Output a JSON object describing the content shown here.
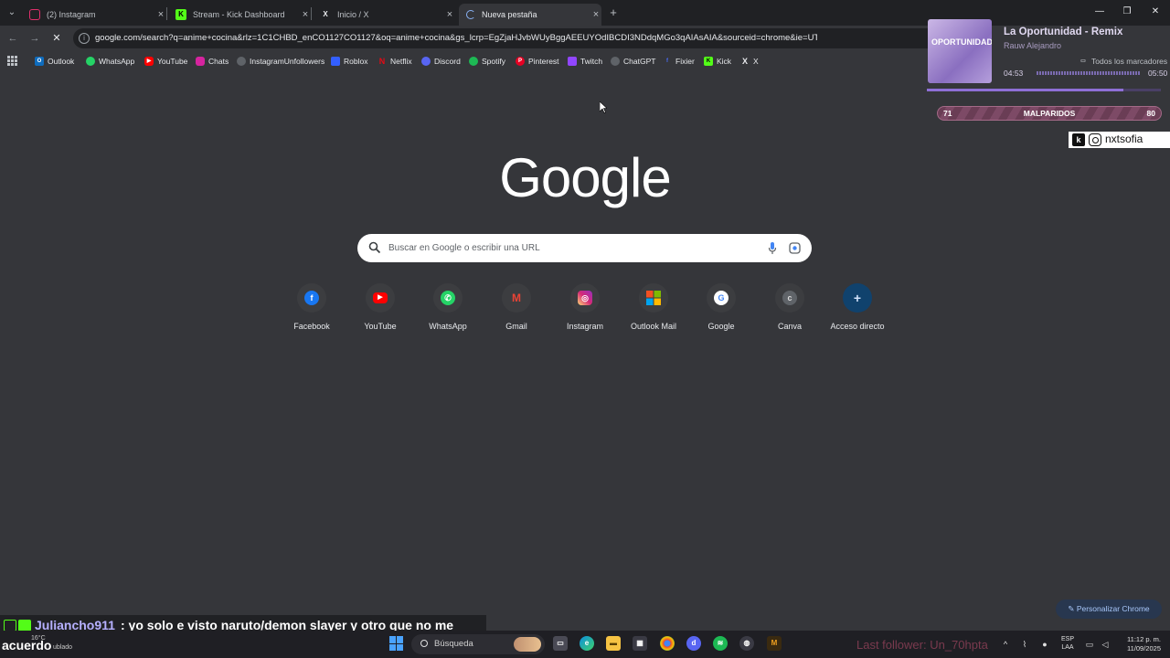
{
  "tabs": [
    {
      "title": "(2) Instagram",
      "icon": "instagram-icon"
    },
    {
      "title": "Stream - Kick Dashboard",
      "icon": "kick-icon"
    },
    {
      "title": "Inicio / X",
      "icon": "x-icon"
    },
    {
      "title": "Nueva pestaña",
      "icon": "loading-spinner-icon",
      "active": true
    }
  ],
  "omnibox": {
    "url": "google.com/search?q=anime+cocina&rlz=1C1CHBD_enCO1127CO1127&oq=anime+cocina&gs_lcrp=EgZjaHJvbWUyBggAEEUYOdIBCDI3NDdqMGo3qAIAsAIA&sourceid=chrome&ie=UTF-8"
  },
  "bookmarks": {
    "items": [
      {
        "label": "Outlook",
        "color": "#0f6cbd"
      },
      {
        "label": "WhatsApp",
        "color": "#25d366"
      },
      {
        "label": "YouTube",
        "color": "#ff0000"
      },
      {
        "label": "Chats",
        "color": "#d6249f"
      },
      {
        "label": "InstagramUnfollowers",
        "color": "#9aa0a6"
      },
      {
        "label": "Roblox",
        "color": "#335fff"
      },
      {
        "label": "Netflix",
        "color": "#e50914"
      },
      {
        "label": "Discord",
        "color": "#5865f2"
      },
      {
        "label": "Spotify",
        "color": "#1db954"
      },
      {
        "label": "Pinterest",
        "color": "#e60023"
      },
      {
        "label": "Twitch",
        "color": "#9146ff"
      },
      {
        "label": "ChatGPT",
        "color": "#9aa0a6"
      },
      {
        "label": "Fixier",
        "color": "#4a6cf7"
      },
      {
        "label": "Kick",
        "color": "#53fc18"
      },
      {
        "label": "X",
        "color": "#000000"
      }
    ],
    "all_label": "Todos los marcadores"
  },
  "google": {
    "logo": "Google",
    "search_placeholder": "Buscar en Google o escribir una URL",
    "shortcuts": [
      {
        "label": "Facebook",
        "color": "#1877f2",
        "glyph": "f"
      },
      {
        "label": "YouTube",
        "color": "#ff0000",
        "glyph": "▶"
      },
      {
        "label": "WhatsApp",
        "color": "#25d366",
        "glyph": "✆"
      },
      {
        "label": "Gmail",
        "color": "#ea4335",
        "glyph": "M"
      },
      {
        "label": "Instagram",
        "color": "#d6249f",
        "glyph": "◎"
      },
      {
        "label": "Outlook Mail",
        "color": "#f25022",
        "glyph": "▦"
      },
      {
        "label": "Google",
        "color": "#ffffff",
        "glyph": "G"
      },
      {
        "label": "Canva",
        "color": "#5f6368",
        "glyph": "c"
      },
      {
        "label": "Acceso directo",
        "color": "#1a73e8",
        "glyph": "+"
      }
    ],
    "customize_label": "Personalizar Chrome"
  },
  "music": {
    "song": "La Oportunidad - Remix",
    "artist": "Rauw Alejandro",
    "cover_text": "OPORTUNIDAD",
    "elapsed": "04:53",
    "total": "05:50",
    "progress": 0.84
  },
  "counter": {
    "left": "71",
    "label": "MALPARIDOS",
    "right": "80"
  },
  "social": {
    "handle": "nxtsofia"
  },
  "chat": {
    "user": "Juliancho911",
    "message": ": yo solo e visto naruto/demon slayer y otro que no me"
  },
  "taskbar": {
    "weather_temp": "16°C",
    "weather_word": "acuerdo",
    "weather_sub": "ublado",
    "search_label": "Búsqueda",
    "last_follower": "Last follower: Un_70hpta",
    "lang_top": "ESP",
    "lang_bottom": "LAA",
    "time": "11:12 p. m.",
    "date": "11/09/2025"
  }
}
